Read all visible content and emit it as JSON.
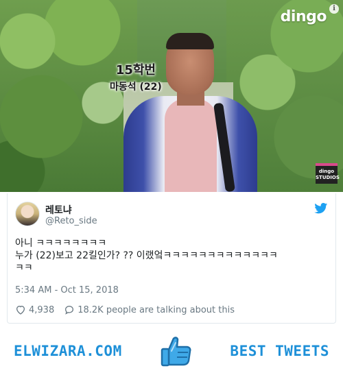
{
  "media": {
    "caption_line1": "15학번",
    "caption_line2": "마동석 (22)",
    "brand": "dingo",
    "info": "i",
    "studios_line1": "dingo",
    "studios_line2": "STUDIOS"
  },
  "tweet": {
    "display_name": "레토냐",
    "handle": "@Reto_side",
    "text_line1": "아니 ㅋㅋㅋㅋㅋㅋㅋㅋ",
    "text_line2": "누가 (22)보고 22킬인가? ?? 이랬엌ㅋㅋㅋㅋㅋㅋㅋㅋㅋㅋㅋㅋㅋ",
    "text_line3": "ㅋㅋ",
    "timestamp": "5:34 AM - Oct 15, 2018",
    "like_count": "4,938",
    "talking": "18.2K people are talking about this"
  },
  "footer": {
    "left_label": "ELWIZARA.COM",
    "right_label": "BEST TWEETS"
  },
  "colors": {
    "accent": "#1e90d8",
    "twitter_blue": "#1da1f2",
    "muted": "#697882"
  }
}
